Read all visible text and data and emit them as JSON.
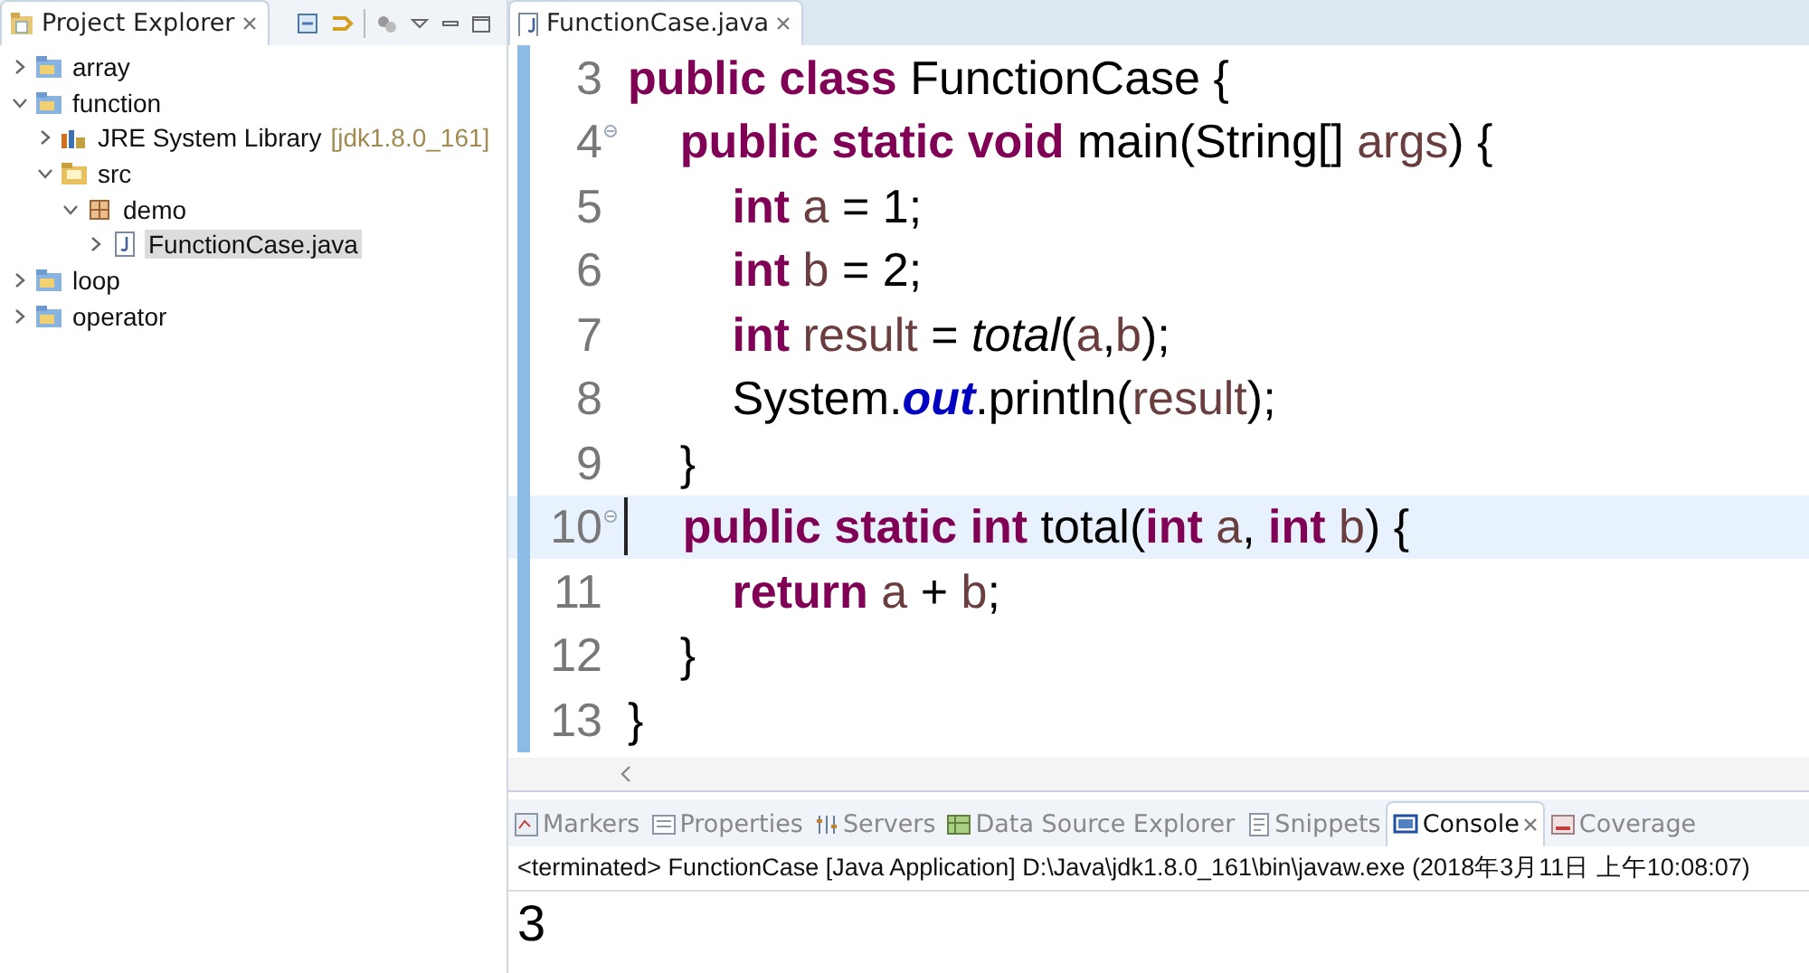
{
  "explorer": {
    "title": "Project Explorer",
    "tree": [
      {
        "label": "array",
        "kind": "project",
        "expanded": false,
        "selected": false
      },
      {
        "label": "function",
        "kind": "project",
        "expanded": true,
        "selected": false,
        "children": [
          {
            "label": "JRE System Library",
            "decoration": "[jdk1.8.0_161]",
            "kind": "library",
            "expanded": false,
            "selected": false
          },
          {
            "label": "src",
            "kind": "source-folder",
            "expanded": true,
            "selected": false,
            "children": [
              {
                "label": "demo",
                "kind": "package",
                "expanded": true,
                "selected": false,
                "children": [
                  {
                    "label": "FunctionCase.java",
                    "kind": "java-file",
                    "expanded": false,
                    "selected": true
                  }
                ]
              }
            ]
          }
        ]
      },
      {
        "label": "loop",
        "kind": "project",
        "expanded": false,
        "selected": false
      },
      {
        "label": "operator",
        "kind": "project",
        "expanded": false,
        "selected": false
      }
    ]
  },
  "editor": {
    "tab": "FunctionCase.java",
    "lines": [
      {
        "number": "3",
        "fold": false,
        "current": false,
        "tokens": [
          {
            "t": "public class",
            "kind": "kw"
          },
          {
            "t": " FunctionCase {",
            "kind": "plain"
          }
        ]
      },
      {
        "number": "4",
        "fold": true,
        "current": false,
        "tokens": [
          {
            "t": "    public static void",
            "kind": "kw"
          },
          {
            "t": " main(String[] ",
            "kind": "plain"
          },
          {
            "t": "args",
            "kind": "var"
          },
          {
            "t": ") {",
            "kind": "plain"
          }
        ]
      },
      {
        "number": "5",
        "fold": false,
        "current": false,
        "tokens": [
          {
            "t": "        int",
            "kind": "kw"
          },
          {
            "t": " a",
            "kind": "var"
          },
          {
            "t": " = 1;",
            "kind": "plain"
          }
        ]
      },
      {
        "number": "6",
        "fold": false,
        "current": false,
        "tokens": [
          {
            "t": "        int",
            "kind": "kw"
          },
          {
            "t": " b",
            "kind": "var"
          },
          {
            "t": " = 2;",
            "kind": "plain"
          }
        ]
      },
      {
        "number": "7",
        "fold": false,
        "current": false,
        "tokens": [
          {
            "t": "        int",
            "kind": "kw"
          },
          {
            "t": " result",
            "kind": "var"
          },
          {
            "t": " = ",
            "kind": "plain"
          },
          {
            "t": "total",
            "kind": "static-method"
          },
          {
            "t": "(",
            "kind": "plain"
          },
          {
            "t": "a",
            "kind": "var"
          },
          {
            "t": ",",
            "kind": "plain"
          },
          {
            "t": "b",
            "kind": "var"
          },
          {
            "t": ");",
            "kind": "plain"
          }
        ]
      },
      {
        "number": "8",
        "fold": false,
        "current": false,
        "tokens": [
          {
            "t": "        System.",
            "kind": "plain"
          },
          {
            "t": "out",
            "kind": "static-field"
          },
          {
            "t": ".println(",
            "kind": "plain"
          },
          {
            "t": "result",
            "kind": "var"
          },
          {
            "t": ");",
            "kind": "plain"
          }
        ]
      },
      {
        "number": "9",
        "fold": false,
        "current": false,
        "tokens": [
          {
            "t": "    }",
            "kind": "plain"
          }
        ]
      },
      {
        "number": "10",
        "fold": true,
        "current": true,
        "tokens": [
          {
            "t": "    public static int",
            "kind": "kw"
          },
          {
            "t": " total(",
            "kind": "plain"
          },
          {
            "t": "int",
            "kind": "kw"
          },
          {
            "t": " a",
            "kind": "var"
          },
          {
            "t": ", ",
            "kind": "plain"
          },
          {
            "t": "int",
            "kind": "kw"
          },
          {
            "t": " b",
            "kind": "var"
          },
          {
            "t": ") {",
            "kind": "plain"
          }
        ]
      },
      {
        "number": "11",
        "fold": false,
        "current": false,
        "tokens": [
          {
            "t": "        return",
            "kind": "kw"
          },
          {
            "t": " a",
            "kind": "var"
          },
          {
            "t": " + ",
            "kind": "plain"
          },
          {
            "t": "b",
            "kind": "var"
          },
          {
            "t": ";",
            "kind": "plain"
          }
        ]
      },
      {
        "number": "12",
        "fold": false,
        "current": false,
        "tokens": [
          {
            "t": "    }",
            "kind": "plain"
          }
        ]
      },
      {
        "number": "13",
        "fold": false,
        "current": false,
        "tokens": [
          {
            "t": "}",
            "kind": "plain"
          }
        ]
      }
    ]
  },
  "bottom_panel": {
    "tabs": [
      {
        "label": "Markers",
        "selected": false
      },
      {
        "label": "Properties",
        "selected": false
      },
      {
        "label": "Servers",
        "selected": false
      },
      {
        "label": "Data Source Explorer",
        "selected": false
      },
      {
        "label": "Snippets",
        "selected": false
      },
      {
        "label": "Console",
        "selected": true
      },
      {
        "label": "Coverage",
        "selected": false
      }
    ],
    "console_header": "<terminated> FunctionCase [Java Application] D:\\Java\\jdk1.8.0_161\\bin\\javaw.exe (2018年3月11日 上午10:08:07)",
    "output": "3"
  }
}
